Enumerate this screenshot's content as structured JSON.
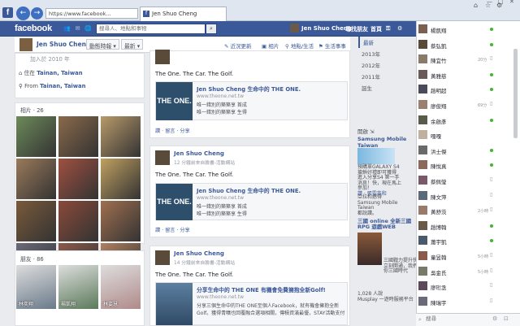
{
  "browser": {
    "address": "https://www.facebook...",
    "tab_title": "Jen Shuo Cheng",
    "fb_letter": "f"
  },
  "topbar": {
    "logo": "facebook",
    "search_placeholder": "搜尋人、地點和事物",
    "user_name": "Jen Shuo Cheng",
    "find_friends": "尋找朋友",
    "home": "首頁"
  },
  "profile_nav": {
    "name": "Jen Shuo Cheng",
    "timeline_btn": "動態時報 ▾",
    "latest_btn": "最新 ▾",
    "status": "近況更新",
    "photo": "相片",
    "place": "地點/生活",
    "life_event": "生活事事"
  },
  "intro": {
    "top_text": "加入於 2010 年",
    "lives_prefix": "住在",
    "lives_city": "Tainan, Taiwan",
    "from_prefix": "From",
    "from_city": "Tainan, Taiwan"
  },
  "photos": {
    "title": "相片 · 26",
    "colors": [
      "#6d8a5a",
      "#8a6a4a",
      "#b89a6a",
      "#9a7a5a",
      "#a05040",
      "#c0a060",
      "#7a5a3a",
      "#8a4a3a",
      "#a07050",
      "#6a6a7a",
      "#8a5a4a",
      "#b08060"
    ]
  },
  "friends": {
    "title": "朋友 · 86",
    "items": [
      {
        "name": "林奕翔",
        "color": "#6a7a8a"
      },
      {
        "name": "楊凱翔",
        "color": "#5a7a5a"
      },
      {
        "name": "林姿慧",
        "color": "#b08a8a"
      }
    ]
  },
  "posts": [
    {
      "name": "",
      "meta": "",
      "text": "The One. The Car. The Golf.",
      "link_title": "Jen Shuo Cheng 生命中的 THE ONE.",
      "link_url": "www.theone.net.tw",
      "link_desc1": "唯一錯別的築築享 首成",
      "link_desc2": "唯一錯別的築築享 生得",
      "link_img": "THE ONE.",
      "actions": "讚 · 留言 · 分享"
    },
    {
      "name": "Jen Shuo Cheng",
      "meta": "12 分鐘前來自臉書-活動網站",
      "text": "The One. The Car. The Golf.",
      "link_title": "Jen Shuo Cheng 生命中的 THE ONE.",
      "link_url": "www.theone.net.tw",
      "link_desc1": "唯一錯別的築築享 首成",
      "link_desc2": "唯一錯別的築築享 生得",
      "link_img": "THE ONE.",
      "actions": "讚 · 留言 · 分享"
    },
    {
      "name": "Jen Shuo Cheng",
      "meta": "14 分鐘前來自臉書-活動網站",
      "text": "The One. The Car. The Golf.",
      "link_title": "分享生命中的 THE ONE 有機會免費擁抱全新Golf!",
      "link_url": "www.theone.net.tw",
      "link_desc1": "分享三個生命中的THE ONE至個人Facebook，就有機會擁抱全新",
      "link_desc2": "Golf。獲得青曠也回覆融合選項相關，傳積資滿最優，STAY活動支付",
      "link_img": "",
      "actions": ""
    }
  ],
  "yearnav": {
    "items": [
      "最新",
      "2013年",
      "2012年",
      "2011年",
      "誕生"
    ]
  },
  "ticker": {
    "open": "開啟",
    "ad1_title": "Samsung Mobile Taiwan",
    "ad1_lines": [
      "預購單GALAXY S4",
      "搶鮮好禮即可獲得",
      "進入分享S4 第一手",
      "消息！快，現在馬上",
      "參加！"
    ],
    "like_line": "讚 · 張雯英和",
    "like_lines": [
      "亞拉和撼得",
      "Samsung Mobile",
      "Taiwan",
      "都說讚。"
    ],
    "ad2_title": "三國 online 全新三國 RPG 遊戲WEB",
    "ad2_lines": [
      "三國戰力提升快",
      "立刻開通，我們發給",
      "你三國時代"
    ],
    "ad2_bottom": "1,028 人說",
    "ad2_foot": "Musplay 一遊時服務平台"
  },
  "chat": {
    "search_placeholder": "搜尋",
    "contacts": [
      {
        "name": "楊凱翔",
        "status": "online",
        "time": ""
      },
      {
        "name": "蔡弘凱",
        "status": "online",
        "time": ""
      },
      {
        "name": "陳宜竹",
        "status": "time",
        "time": "20分"
      },
      {
        "name": "黃雅慈",
        "status": "online",
        "time": ""
      },
      {
        "name": "趙明超",
        "status": "online",
        "time": ""
      },
      {
        "name": "廖俊翔",
        "status": "time",
        "time": "69分"
      },
      {
        "name": "余啟彥",
        "status": "online",
        "time": ""
      },
      {
        "name": "嘎嘎",
        "status": "none",
        "time": ""
      },
      {
        "name": "洪士傑",
        "status": "online",
        "time": ""
      },
      {
        "name": "陳悅真",
        "status": "online",
        "time": ""
      },
      {
        "name": "蔡佩瑩",
        "status": "mobile",
        "time": ""
      },
      {
        "name": "陳文萍",
        "status": "mobile",
        "time": ""
      },
      {
        "name": "黃舒茨",
        "status": "time",
        "time": "2小時"
      },
      {
        "name": "趙博翰",
        "status": "online",
        "time": ""
      },
      {
        "name": "蕭宇凱",
        "status": "online",
        "time": ""
      },
      {
        "name": "童昱翰",
        "status": "time",
        "time": "5小時"
      },
      {
        "name": "吳金氏",
        "status": "time",
        "time": "5小時"
      },
      {
        "name": "廖珩丞",
        "status": "mobile",
        "time": ""
      },
      {
        "name": "陳瑞宇",
        "status": "mobile",
        "time": ""
      }
    ]
  }
}
